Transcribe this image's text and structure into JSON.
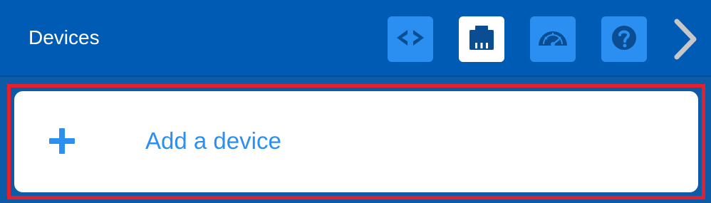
{
  "header": {
    "title": "Devices"
  },
  "toolbar": {
    "buttons": [
      {
        "icon": "code-brackets-icon",
        "active": false
      },
      {
        "icon": "ethernet-port-icon",
        "active": true
      },
      {
        "icon": "gauge-icon",
        "active": false
      },
      {
        "icon": "help-icon",
        "active": false
      }
    ],
    "next_icon": "chevron-right-icon"
  },
  "device_list": {
    "add_item": {
      "icon": "plus-icon",
      "label": "Add a device"
    },
    "highlight_color": "#e3202b"
  },
  "colors": {
    "header_bg": "#005bb5",
    "button_bg": "#2a8ff0",
    "button_active_bg": "#ffffff",
    "accent_text": "#2d8ff0"
  }
}
